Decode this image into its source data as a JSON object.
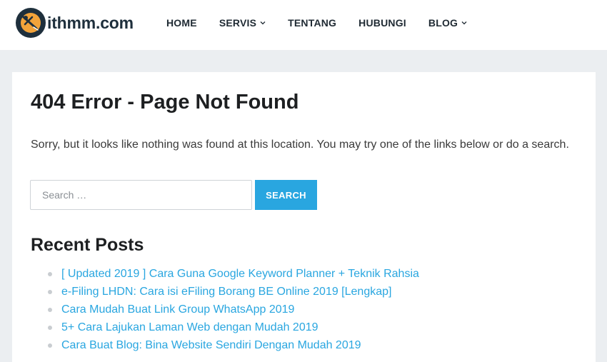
{
  "brand": {
    "name": "ithmm.com"
  },
  "nav": {
    "items": [
      {
        "label": "HOME",
        "has_dropdown": false
      },
      {
        "label": "SERVIS",
        "has_dropdown": true
      },
      {
        "label": "TENTANG",
        "has_dropdown": false
      },
      {
        "label": "HUBUNGI",
        "has_dropdown": false
      },
      {
        "label": "BLOG",
        "has_dropdown": true
      }
    ]
  },
  "page": {
    "title": "404 Error - Page Not Found",
    "message": "Sorry, but it looks like nothing was found at this location. You may try one of the links below or do a search."
  },
  "search": {
    "placeholder": "Search …",
    "value": "",
    "button_label": "SEARCH"
  },
  "recent_posts": {
    "title": "Recent Posts",
    "items": [
      "[ Updated 2019 ] Cara Guna Google Keyword Planner + Teknik Rahsia",
      "e-Filing LHDN: Cara isi eFiling Borang BE Online 2019 [Lengkap]",
      "Cara Mudah Buat Link Group WhatsApp 2019",
      "5+ Cara Lajukan Laman Web dengan Mudah 2019",
      "Cara Buat Blog: Bina Website Sendiri Dengan Mudah 2019"
    ]
  },
  "colors": {
    "accent": "#29a6e0",
    "logo_navy": "#1e2f3c",
    "logo_orange": "#f2a33a",
    "page_background": "#ebeef1"
  },
  "icons": {
    "logo": "satellite-logo-icon",
    "dropdown": "chevron-down-icon",
    "bullet": "bullet-icon"
  }
}
